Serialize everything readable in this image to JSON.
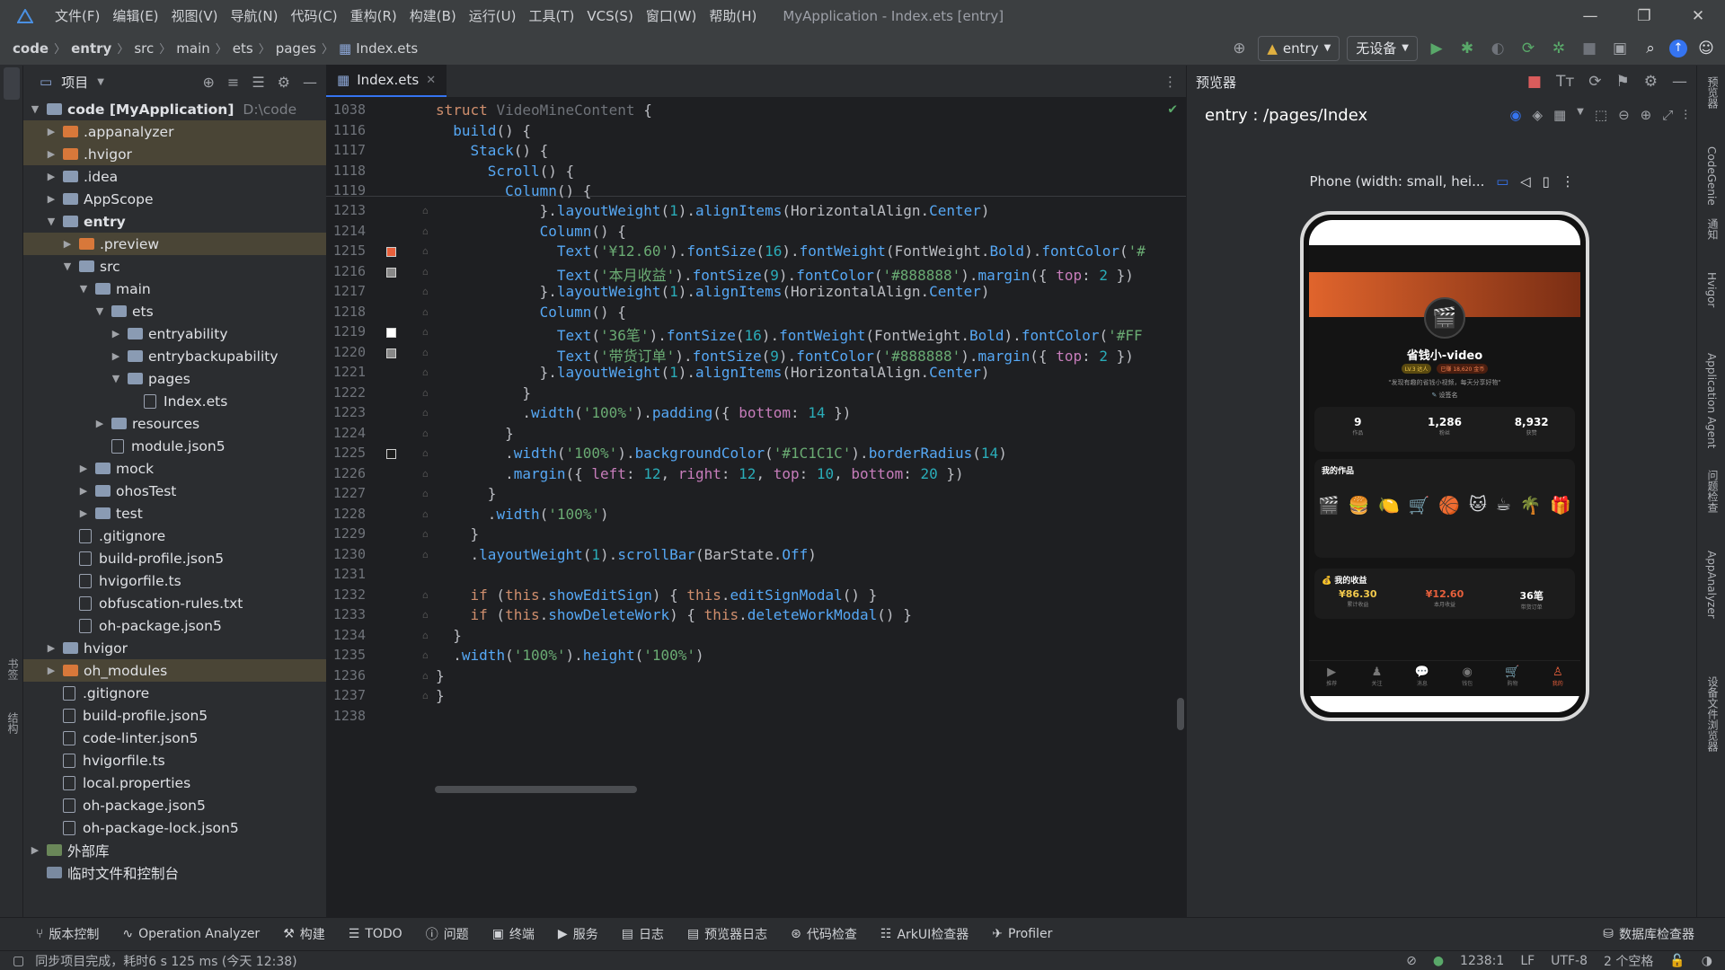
{
  "menu": {
    "items": [
      "文件(F)",
      "编辑(E)",
      "视图(V)",
      "导航(N)",
      "代码(C)",
      "重构(R)",
      "构建(B)",
      "运行(U)",
      "工具(T)",
      "VCS(S)",
      "窗口(W)",
      "帮助(H)"
    ],
    "title": "MyApplication - Index.ets [entry]"
  },
  "breadcrumb": [
    "code",
    "entry",
    "src",
    "main",
    "ets",
    "pages",
    "Index.ets"
  ],
  "toolbar": {
    "module": "entry",
    "device": "无设备"
  },
  "project": {
    "header": "项目",
    "tree": [
      {
        "level": 0,
        "arrow": "v",
        "type": "folder",
        "label": "code [MyApplication]",
        "hint": "D:\\code",
        "bold": true
      },
      {
        "level": 1,
        "arrow": ">",
        "type": "folder-o",
        "label": ".appanalyzer",
        "sel": true
      },
      {
        "level": 1,
        "arrow": ">",
        "type": "folder-o",
        "label": ".hvigor",
        "sel": true
      },
      {
        "level": 1,
        "arrow": ">",
        "type": "folder",
        "label": ".idea"
      },
      {
        "level": 1,
        "arrow": ">",
        "type": "folder",
        "label": "AppScope"
      },
      {
        "level": 1,
        "arrow": "v",
        "type": "folder",
        "label": "entry",
        "bold": true
      },
      {
        "level": 2,
        "arrow": ">",
        "type": "folder-o",
        "label": ".preview",
        "sel": true
      },
      {
        "level": 2,
        "arrow": "v",
        "type": "folder",
        "label": "src"
      },
      {
        "level": 3,
        "arrow": "v",
        "type": "folder",
        "label": "main"
      },
      {
        "level": 4,
        "arrow": "v",
        "type": "folder",
        "label": "ets"
      },
      {
        "level": 5,
        "arrow": ">",
        "type": "folder",
        "label": "entryability"
      },
      {
        "level": 5,
        "arrow": ">",
        "type": "folder",
        "label": "entrybackupability"
      },
      {
        "level": 5,
        "arrow": "v",
        "type": "folder",
        "label": "pages"
      },
      {
        "level": 6,
        "arrow": "",
        "type": "file",
        "label": "Index.ets"
      },
      {
        "level": 4,
        "arrow": ">",
        "type": "folder",
        "label": "resources"
      },
      {
        "level": 4,
        "arrow": "",
        "type": "file",
        "label": "module.json5"
      },
      {
        "level": 3,
        "arrow": ">",
        "type": "folder",
        "label": "mock"
      },
      {
        "level": 3,
        "arrow": ">",
        "type": "folder",
        "label": "ohosTest"
      },
      {
        "level": 3,
        "arrow": ">",
        "type": "folder",
        "label": "test"
      },
      {
        "level": 2,
        "arrow": "",
        "type": "file",
        "label": ".gitignore"
      },
      {
        "level": 2,
        "arrow": "",
        "type": "file",
        "label": "build-profile.json5"
      },
      {
        "level": 2,
        "arrow": "",
        "type": "file",
        "label": "hvigorfile.ts"
      },
      {
        "level": 2,
        "arrow": "",
        "type": "file",
        "label": "obfuscation-rules.txt"
      },
      {
        "level": 2,
        "arrow": "",
        "type": "file",
        "label": "oh-package.json5"
      },
      {
        "level": 1,
        "arrow": ">",
        "type": "folder",
        "label": "hvigor"
      },
      {
        "level": 1,
        "arrow": ">",
        "type": "folder-o",
        "label": "oh_modules",
        "sel": true
      },
      {
        "level": 1,
        "arrow": "",
        "type": "file",
        "label": ".gitignore"
      },
      {
        "level": 1,
        "arrow": "",
        "type": "file",
        "label": "build-profile.json5"
      },
      {
        "level": 1,
        "arrow": "",
        "type": "file",
        "label": "code-linter.json5"
      },
      {
        "level": 1,
        "arrow": "",
        "type": "file",
        "label": "hvigorfile.ts"
      },
      {
        "level": 1,
        "arrow": "",
        "type": "file",
        "label": "local.properties"
      },
      {
        "level": 1,
        "arrow": "",
        "type": "file",
        "label": "oh-package.json5"
      },
      {
        "level": 1,
        "arrow": "",
        "type": "file",
        "label": "oh-package-lock.json5"
      },
      {
        "level": 0,
        "arrow": ">",
        "type": "lib",
        "label": "外部库"
      },
      {
        "level": 0,
        "arrow": "",
        "type": "scratch",
        "label": "临时文件和控制台"
      }
    ]
  },
  "editor": {
    "tab": "Index.ets",
    "sticky": [
      {
        "n": "1038",
        "code": "struct VideoMineContent {"
      },
      {
        "n": "1116",
        "code": "  build() {"
      },
      {
        "n": "1117",
        "code": "    Stack() {"
      },
      {
        "n": "1118",
        "code": "      Scroll() {"
      },
      {
        "n": "1119",
        "code": "        Column() {"
      }
    ],
    "lines": [
      {
        "n": "1213",
        "code": "            }.layoutWeight(1).alignItems(HorizontalAlign.Center)"
      },
      {
        "n": "1214",
        "code": "            Column() {"
      },
      {
        "n": "1215",
        "code": "              Text('¥12.60').fontSize(16).fontWeight(FontWeight.Bold).fontColor('#",
        "mk": "#e8603c"
      },
      {
        "n": "1216",
        "code": "              Text('本月收益').fontSize(9).fontColor('#888888').margin({ top: 2 })",
        "mk": "#888888"
      },
      {
        "n": "1217",
        "code": "            }.layoutWeight(1).alignItems(HorizontalAlign.Center)"
      },
      {
        "n": "1218",
        "code": "            Column() {"
      },
      {
        "n": "1219",
        "code": "              Text('36笔').fontSize(16).fontWeight(FontWeight.Bold).fontColor('#FF",
        "mk": "#ffffff"
      },
      {
        "n": "1220",
        "code": "              Text('带货订单').fontSize(9).fontColor('#888888').margin({ top: 2 })",
        "mk": "#888888"
      },
      {
        "n": "1221",
        "code": "            }.layoutWeight(1).alignItems(HorizontalAlign.Center)"
      },
      {
        "n": "1222",
        "code": "          }"
      },
      {
        "n": "1223",
        "code": "          .width('100%').padding({ bottom: 14 })"
      },
      {
        "n": "1224",
        "code": "        }"
      },
      {
        "n": "1225",
        "code": "        .width('100%').backgroundColor('#1C1C1C').borderRadius(14)",
        "mk": "#1c1c1c"
      },
      {
        "n": "1226",
        "code": "        .margin({ left: 12, right: 12, top: 10, bottom: 20 })"
      },
      {
        "n": "1227",
        "code": "      }"
      },
      {
        "n": "1228",
        "code": "      .width('100%')"
      },
      {
        "n": "1229",
        "code": "    }"
      },
      {
        "n": "1230",
        "code": "    .layoutWeight(1).scrollBar(BarState.Off)"
      },
      {
        "n": "1231",
        "code": ""
      },
      {
        "n": "1232",
        "code": "    if (this.showEditSign) { this.editSignModal() }"
      },
      {
        "n": "1233",
        "code": "    if (this.showDeleteWork) { this.deleteWorkModal() }"
      },
      {
        "n": "1234",
        "code": "  }"
      },
      {
        "n": "1235",
        "code": "  .width('100%').height('100%')"
      },
      {
        "n": "1236",
        "code": "}"
      },
      {
        "n": "1237",
        "code": "}"
      },
      {
        "n": "1238",
        "code": ""
      }
    ]
  },
  "preview": {
    "header": "预览器",
    "route": "entry : /pages/Index",
    "device": "Phone (width: small, hei...",
    "app": {
      "name": "省钱小-video",
      "badge1": "LV.3 达人",
      "badge2": "已赚 18,620 金币",
      "bio": "\"发现有趣的省钱小视频，每天分享好物\"",
      "sign": "设签名",
      "stats": [
        {
          "v": "9",
          "l": "作品"
        },
        {
          "v": "1,286",
          "l": "粉丝"
        },
        {
          "v": "8,932",
          "l": "获赞"
        }
      ],
      "works_title": "我的作品",
      "works_icons": [
        "🎬",
        "🍔",
        "🍋",
        "🛒",
        "🏀",
        "🐱",
        "☕",
        "🌴",
        "🎁"
      ],
      "income_title": "我的收益",
      "income": [
        {
          "v": "¥86.30",
          "l": "累计收益"
        },
        {
          "v": "¥12.60",
          "l": "本月收益"
        },
        {
          "v": "36笔",
          "l": "带货订单"
        }
      ],
      "tabs": [
        "推荐",
        "关注",
        "消息",
        "钱包",
        "购物",
        "我的"
      ]
    }
  },
  "bottom_tools": [
    "版本控制",
    "Operation Analyzer",
    "构建",
    "TODO",
    "问题",
    "终端",
    "服务",
    "日志",
    "预览器日志",
    "代码检查",
    "ArkUI检查器",
    "Profiler",
    "数据库检查器"
  ],
  "status": {
    "message": "同步项目完成，耗时6 s 125 ms (今天 12:38)",
    "position": "1238:1",
    "eol": "LF",
    "encoding": "UTF-8",
    "indent": "2 个空格"
  }
}
